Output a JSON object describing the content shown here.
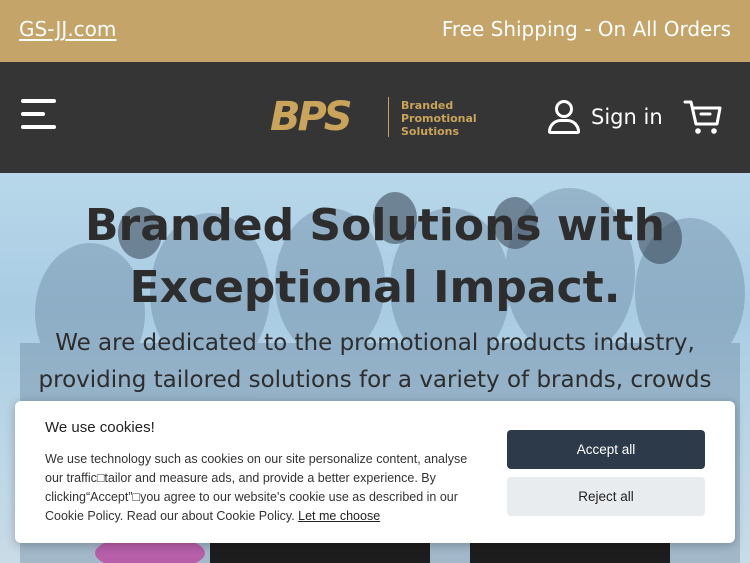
{
  "topbar": {
    "site_link": "GS-JJ.com",
    "promo": "Free Shipping - On All Orders"
  },
  "header": {
    "logo_mark": "BPS",
    "logo_tagline": [
      "Branded",
      "Promotional",
      "Solutions"
    ],
    "signin_label": "Sign in"
  },
  "hero": {
    "title_line1": "Branded Solutions with",
    "title_line2": "Exceptional Impact.",
    "lead_line1": "We are dedicated to the promotional products industry,",
    "lead_line2": "providing tailored solutions for a variety of brands, crowds"
  },
  "cookie": {
    "title": "We use cookies!",
    "message": "We use technology such as cookies on our site personalize content, analyse our traffic□tailor and measure ads, and provide a better experience. By clicking“Accept”□you agree to our website's cookie use as described in our Cookie Policy. Read our about Cookie Policy.",
    "choose_link": "Let me choose",
    "accept_label": "Accept all",
    "reject_label": "Reject all"
  },
  "colors": {
    "gold": "#c4a468",
    "header_bg": "#353535",
    "accept_bg": "#2d3a4a",
    "reject_bg": "#e9ecef"
  }
}
